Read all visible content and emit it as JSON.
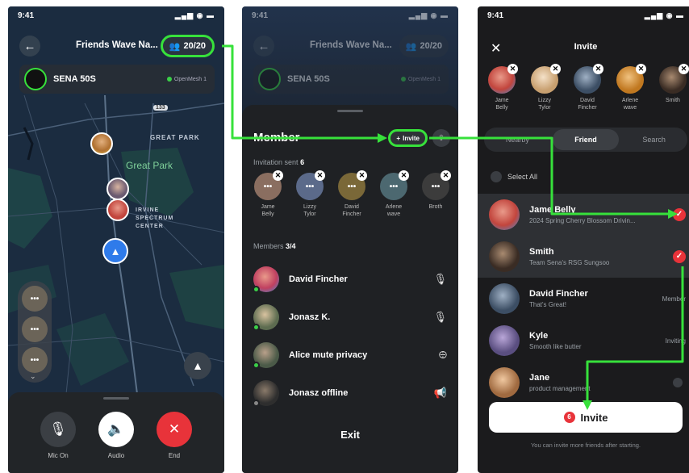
{
  "colors": {
    "accent_green": "#37e13b",
    "brand_red": "#e8333a",
    "nav_blue": "#2f7bea"
  },
  "status_time": "9:41",
  "screen1": {
    "title": "Friends Wave Na...",
    "count": "20/20",
    "device": {
      "name": "SENA 50S",
      "mesh": "OpenMesh 1"
    },
    "map_labels": {
      "great_park_caps": "GREAT PARK",
      "great_park": "Great Park",
      "irvine": "IRVINE\nSPECTRUM\nCENTER",
      "route": "133"
    },
    "stack_dots": "•••",
    "controls": [
      {
        "label": "Mic On",
        "icon": "mic-icon"
      },
      {
        "label": "Audio",
        "icon": "speaker-icon"
      },
      {
        "label": "End",
        "icon": "close-icon"
      }
    ]
  },
  "screen2": {
    "title": "Friends Wave Na...",
    "count": "20/20",
    "device": {
      "name": "SENA 50S",
      "mesh": "OpenMesh 1"
    },
    "section_title": "Member",
    "invite_label": "Invite",
    "invitation_label": "Invitation sent",
    "invitation_count": "6",
    "invited": [
      {
        "name": "Jame\nBelly"
      },
      {
        "name": "Lizzy\nTylor"
      },
      {
        "name": "David\nFincher"
      },
      {
        "name": "Arlene\nwave"
      },
      {
        "name": "Broth"
      }
    ],
    "members_label": "Members",
    "members_count": "3/4",
    "members": [
      {
        "name": "David Fincher",
        "status": "online",
        "icon": "mic-icon"
      },
      {
        "name": "Jonasz K.",
        "status": "online",
        "icon": "mic-icon"
      },
      {
        "name": "Alice mute privacy",
        "status": "online",
        "icon": "mic-muted-icon"
      },
      {
        "name": "Jonasz offline",
        "status": "offline",
        "icon": "megaphone-icon"
      }
    ],
    "exit_label": "Exit"
  },
  "screen3": {
    "title": "Invite",
    "selected": [
      {
        "name": "Jame\nBelly"
      },
      {
        "name": "Lizzy\nTylor"
      },
      {
        "name": "David\nFincher"
      },
      {
        "name": "Arlene\nwave"
      },
      {
        "name": "Smith"
      }
    ],
    "tabs": [
      "Nearby",
      "Friend",
      "Search"
    ],
    "active_tab": "Friend",
    "select_all": "Select All",
    "friends": [
      {
        "name": "Jame Belly",
        "sub": "2024 Spring Cherry Blossom Drivin...",
        "state": "checked"
      },
      {
        "name": "Smith",
        "sub": "Team Sena's RSG Sungsoo",
        "state": "checked"
      },
      {
        "name": "David Fincher",
        "sub": "That's Great!",
        "state": "Member"
      },
      {
        "name": "Kyle",
        "sub": "Smooth like butter",
        "state": "Inviting"
      },
      {
        "name": "Jane",
        "sub": "product management",
        "state": "unchecked"
      }
    ],
    "invite_button": "Invite",
    "invite_count": "6",
    "footnote": "You can invite more friends after starting."
  }
}
